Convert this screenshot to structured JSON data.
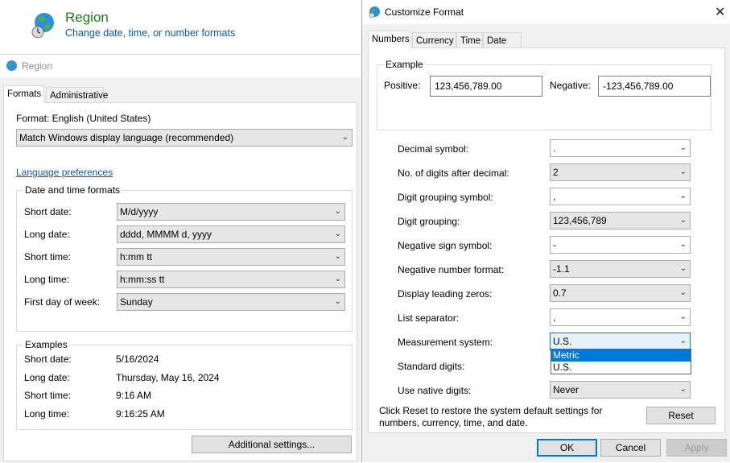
{
  "settings_header": {
    "title": "Region",
    "subtitle": "Change date, time, or number formats"
  },
  "region": {
    "title": "Region",
    "tabs": [
      "Formats",
      "Administrative"
    ],
    "format_label": "Format: English (United States)",
    "format_value": "Match Windows display language (recommended)",
    "language_link": "Language preferences",
    "dt_group_title": "Date and time formats",
    "dt_rows": [
      {
        "label": "Short date:",
        "value": "M/d/yyyy"
      },
      {
        "label": "Long date:",
        "value": "dddd, MMMM d, yyyy"
      },
      {
        "label": "Short time:",
        "value": "h:mm tt"
      },
      {
        "label": "Long time:",
        "value": "h:mm:ss tt"
      },
      {
        "label": "First day of week:",
        "value": "Sunday"
      }
    ],
    "examples_title": "Examples",
    "examples": [
      {
        "label": "Short date:",
        "value": "5/16/2024"
      },
      {
        "label": "Long date:",
        "value": "Thursday, May 16, 2024"
      },
      {
        "label": "Short time:",
        "value": "9:16 AM"
      },
      {
        "label": "Long time:",
        "value": "9:16:25 AM"
      }
    ],
    "additional_button": "Additional settings..."
  },
  "customize": {
    "title": "Customize Format",
    "close_glyph": "✕",
    "tabs": [
      "Numbers",
      "Currency",
      "Time",
      "Date"
    ],
    "example_title": "Example",
    "positive_label": "Positive:",
    "positive_value": "123,456,789.00",
    "negative_label": "Negative:",
    "negative_value": "-123,456,789.00",
    "rows": [
      {
        "label": "Decimal symbol:",
        "value": "."
      },
      {
        "label": "No. of digits after decimal:",
        "value": "2"
      },
      {
        "label": "Digit grouping symbol:",
        "value": ","
      },
      {
        "label": "Digit grouping:",
        "value": "123,456,789"
      },
      {
        "label": "Negative sign symbol:",
        "value": "-"
      },
      {
        "label": "Negative number format:",
        "value": "-1.1"
      },
      {
        "label": "Display leading zeros:",
        "value": "0.7"
      },
      {
        "label": "List separator:",
        "value": ","
      },
      {
        "label": "Measurement system:",
        "value": "U.S."
      },
      {
        "label": "Standard digits:",
        "value": ""
      },
      {
        "label": "Use native digits:",
        "value": "Never"
      }
    ],
    "measurement_options": [
      "Metric",
      "U.S."
    ],
    "reset_note": "Click Reset to restore the system default settings for numbers, currency, time, and date.",
    "reset_button": "Reset",
    "ok_button": "OK",
    "cancel_button": "Cancel",
    "apply_button": "Apply"
  },
  "colors": {
    "accent": "#0078d7",
    "header_title": "#1e7b1e",
    "link": "#0b5aa8"
  }
}
